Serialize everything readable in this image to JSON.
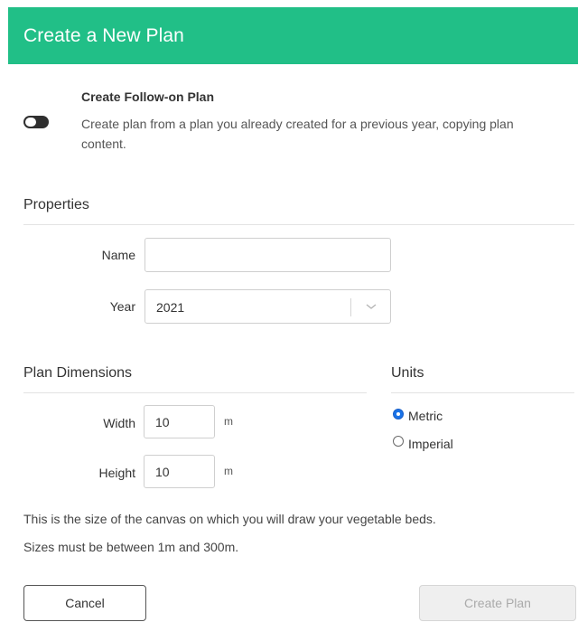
{
  "header": {
    "title": "Create a New Plan"
  },
  "follow_on": {
    "enabled": false,
    "title": "Create Follow-on Plan",
    "description": "Create plan from a plan you already created for a previous year, copying plan content."
  },
  "properties": {
    "section_title": "Properties",
    "name": {
      "label": "Name",
      "value": "",
      "placeholder": ""
    },
    "year": {
      "label": "Year",
      "value": "2021"
    }
  },
  "dimensions": {
    "section_title": "Plan Dimensions",
    "width": {
      "label": "Width",
      "value": "10",
      "unit": "m"
    },
    "height": {
      "label": "Height",
      "value": "10",
      "unit": "m"
    }
  },
  "units": {
    "section_title": "Units",
    "options": [
      {
        "label": "Metric",
        "selected": true
      },
      {
        "label": "Imperial",
        "selected": false
      }
    ]
  },
  "info": {
    "line1": "This is the size of the canvas on which you will draw your vegetable beds.",
    "line2": "Sizes must be between 1m and 300m."
  },
  "buttons": {
    "cancel": "Cancel",
    "create": "Create Plan"
  },
  "colors": {
    "header_bg": "#21bf87",
    "radio_selected": "#1a73e8"
  },
  "icons": {
    "toggle": "toggle-switch-off",
    "select_chevron": "chevron-down-icon"
  }
}
